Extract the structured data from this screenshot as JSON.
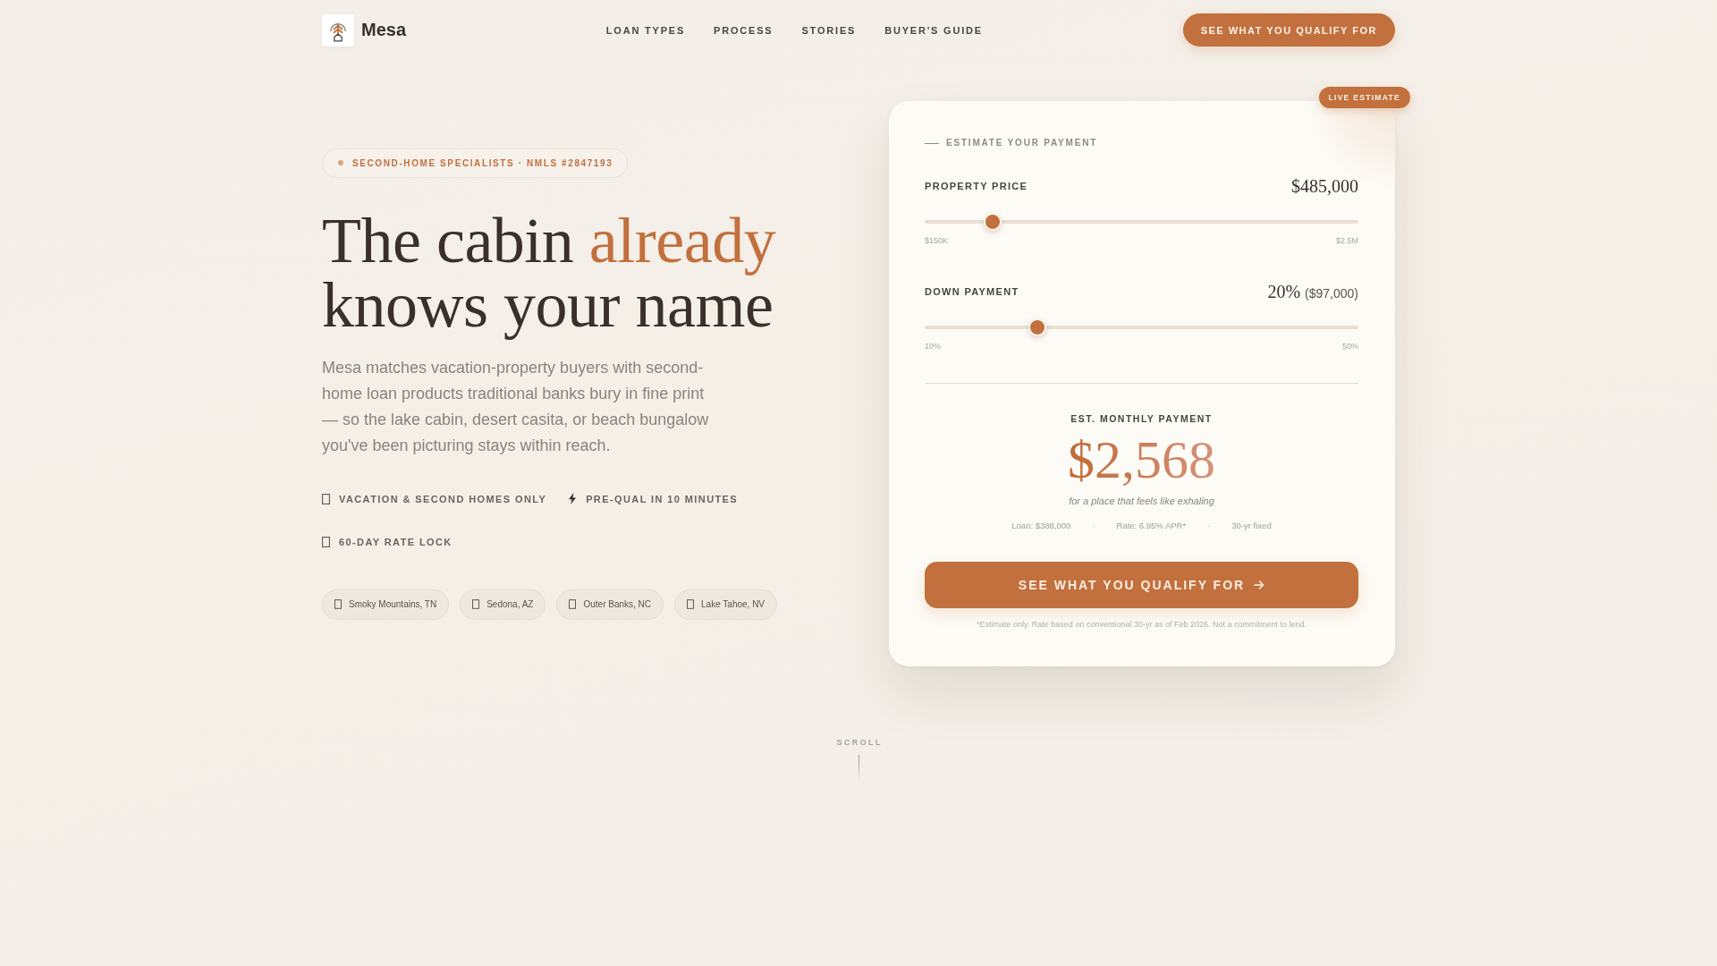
{
  "header": {
    "brand": "Mesa",
    "nav": [
      {
        "label": "LOAN TYPES"
      },
      {
        "label": "PROCESS"
      },
      {
        "label": "STORIES"
      },
      {
        "label": "BUYER'S GUIDE"
      }
    ],
    "cta": "SEE WHAT YOU QUALIFY FOR"
  },
  "hero": {
    "badge": "SECOND-HOME SPECIALISTS · NMLS #2847193",
    "headline": [
      {
        "text": "The cabin",
        "accent": false
      },
      {
        "text": "already",
        "accent": true
      },
      {
        "text": "knows your name",
        "accent": false
      }
    ],
    "intro": "Mesa matches vacation-property buyers with second-home loan products traditional banks bury in fine print — so the lake cabin, desert casita, or beach bungalow you've been picturing stays within reach.",
    "features": [
      {
        "kind": "generic",
        "text": "VACATION & SECOND HOMES ONLY"
      },
      {
        "kind": "bolt",
        "text": "PRE-QUAL IN 10 MINUTES"
      },
      {
        "kind": "generic",
        "text": "60-DAY RATE LOCK"
      }
    ],
    "locations": [
      "Smoky Mountains, TN",
      "Sedona, AZ",
      "Outer Banks, NC",
      "Lake Tahoe, NV"
    ]
  },
  "calculator": {
    "badge": "LIVE ESTIMATE",
    "eyebrow": "ESTIMATE YOUR PAYMENT",
    "sliders": [
      {
        "label": "PROPERTY PRICE",
        "value": "$485,000",
        "level": 0.143,
        "min_label": "$150K",
        "max_label": "$2.5M"
      },
      {
        "label": "DOWN PAYMENT",
        "value": "20%",
        "value_note": "($97,000)",
        "level": 0.25,
        "min_label": "10%",
        "max_label": "50%"
      }
    ],
    "result": {
      "label": "EST. MONTHLY PAYMENT",
      "amount": "$2,568",
      "tagline": "for a place that feels like exhaling",
      "details": [
        {
          "kind": "item",
          "text": "Loan: $388,000"
        },
        {
          "kind": "separator",
          "text": "·"
        },
        {
          "kind": "item",
          "text": "Rate: 6.95% APR*"
        },
        {
          "kind": "separator",
          "text": "·"
        },
        {
          "kind": "item",
          "text": "30-yr fixed"
        }
      ]
    },
    "cta": "SEE WHAT YOU QUALIFY FOR",
    "disclaimer": "*Estimate only. Rate based on conventional 30-yr as of Feb 2026. Not a commitment to lend."
  },
  "scroll": {
    "label": "SCROLL"
  }
}
